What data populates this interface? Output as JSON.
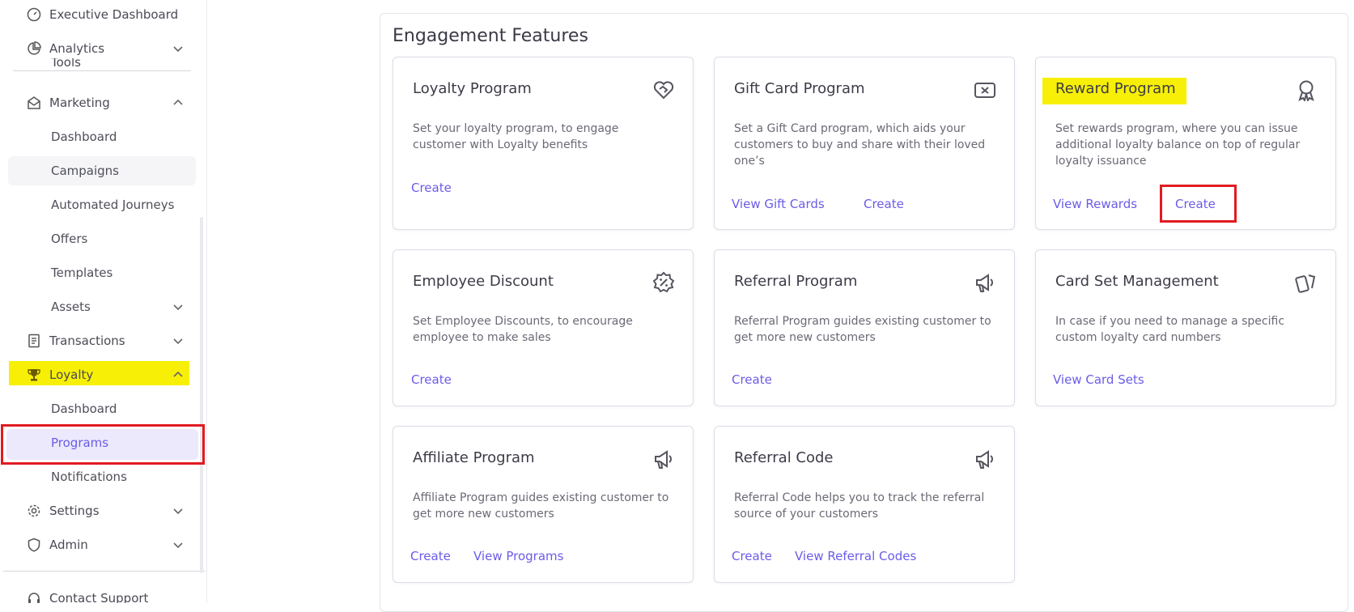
{
  "sidebar": {
    "executive_dashboard": "Executive Dashboard",
    "analytics": "Analytics",
    "tools_clipped": "Tools",
    "marketing": "Marketing",
    "marketing_items": [
      "Dashboard",
      "Campaigns",
      "Automated Journeys",
      "Offers",
      "Templates",
      "Assets"
    ],
    "transactions": "Transactions",
    "loyalty": "Loyalty",
    "loyalty_items": [
      "Dashboard",
      "Programs",
      "Notifications"
    ],
    "settings": "Settings",
    "admin": "Admin",
    "contact_support": "Contact Support",
    "active_item": "Programs"
  },
  "main": {
    "title": "Engagement Features",
    "cards": [
      {
        "title": "Loyalty Program",
        "desc": "Set your loyalty program, to engage customer with Loyalty benefits",
        "icon": "heart-handshake-icon",
        "actions": [
          "Create"
        ]
      },
      {
        "title": "Gift Card Program",
        "desc": "Set a Gift Card program, which aids your customers to buy and share with their loved one’s",
        "icon": "gift-card-icon",
        "actions": [
          "View Gift Cards",
          "Create"
        ]
      },
      {
        "title": "Reward Program",
        "desc": "Set rewards program, where you can issue additional loyalty balance on top of regular loyalty issuance",
        "icon": "award-ribbon-icon",
        "actions": [
          "View Rewards",
          "Create"
        ]
      },
      {
        "title": "Employee Discount",
        "desc": "Set Employee Discounts, to encourage employee to make sales",
        "icon": "discount-badge-icon",
        "actions": [
          "Create"
        ]
      },
      {
        "title": "Referral Program",
        "desc": "Referral Program guides existing customer to get more new customers",
        "icon": "megaphone-icon",
        "actions": [
          "Create"
        ]
      },
      {
        "title": "Card Set Management",
        "desc": "In case if you need to manage a specific custom loyalty card numbers",
        "icon": "cards-icon",
        "actions": [
          "View Card Sets"
        ]
      },
      {
        "title": "Affiliate Program",
        "desc": "Affiliate Program guides existing customer to get more new customers",
        "icon": "megaphone-icon",
        "actions": [
          "Create",
          "View Programs"
        ]
      },
      {
        "title": "Referral Code",
        "desc": "Referral Code helps you to track the referral source of your customers",
        "icon": "megaphone-icon",
        "actions": [
          "Create",
          "View Referral Codes"
        ]
      }
    ]
  },
  "colors": {
    "accent": "#6b5ce7",
    "highlight": "#f7ef05",
    "annotation_box": "#e11b22",
    "active_bg": "#ebe9fb"
  }
}
